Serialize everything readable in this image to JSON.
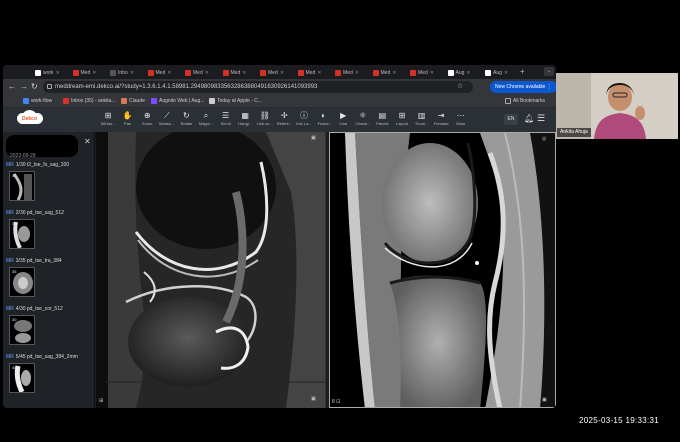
{
  "tabs": [
    {
      "label": "work",
      "color": "#ffffff"
    },
    {
      "label": "Med",
      "color": "#d93025"
    },
    {
      "label": "Inbo",
      "color": "#555555"
    },
    {
      "label": "Med",
      "color": "#d93025"
    },
    {
      "label": "Med",
      "color": "#d93025"
    },
    {
      "label": "Med",
      "color": "#d93025"
    },
    {
      "label": "Med",
      "color": "#d93025"
    },
    {
      "label": "Med",
      "color": "#d93025"
    },
    {
      "label": "Med",
      "color": "#d93025"
    },
    {
      "label": "Med",
      "color": "#d93025"
    },
    {
      "label": "Med",
      "color": "#d93025"
    },
    {
      "label": "Aug",
      "color": "#ffffff"
    },
    {
      "label": "Aug",
      "color": "#ffffff"
    }
  ],
  "address_bar": {
    "url": "meddream-emi.dekco.ai/?study=1.3.6.1.4.1.58981.29498098335632863880491630926141093993",
    "chrome_button": "New Chrome available"
  },
  "bookmarks": [
    {
      "label": "work-flow",
      "color": "#4285f4"
    },
    {
      "label": "Inbox (35) - ankita...",
      "color": "#d93025"
    },
    {
      "label": "Claude",
      "color": "#d97757"
    },
    {
      "label": "Augnito Web | Aug...",
      "color": "#7c4dff"
    },
    {
      "label": "Today at Apple - C...",
      "color": "#cccccc"
    }
  ],
  "all_bookmarks": "All Bookmarks",
  "logo_text": "Dekco",
  "toolbar": [
    {
      "label": "Windo...",
      "icon": "⊞",
      "name": "windows"
    },
    {
      "label": "Pan",
      "icon": "✋",
      "name": "pan"
    },
    {
      "label": "Zoom",
      "icon": "⊕",
      "name": "zoom"
    },
    {
      "label": "Measu...",
      "icon": "⟋",
      "name": "measure"
    },
    {
      "label": "Rotate",
      "icon": "↻",
      "name": "rotate"
    },
    {
      "label": "Magni...",
      "icon": "⌕",
      "name": "magnify"
    },
    {
      "label": "Scroll",
      "icon": "☰",
      "name": "scroll"
    },
    {
      "label": "Hangi...",
      "icon": "▦",
      "name": "hanging"
    },
    {
      "label": "Link sc...",
      "icon": "⛓",
      "name": "link-scroll"
    },
    {
      "label": "Refere...",
      "icon": "✢",
      "name": "reference"
    },
    {
      "label": "Info La...",
      "icon": "ⓘ",
      "name": "info-layer"
    },
    {
      "label": "Fusion",
      "icon": "◐",
      "name": "fusion"
    },
    {
      "label": "Cine",
      "icon": "▶",
      "name": "cine"
    },
    {
      "label": "Chann...",
      "icon": "⚛",
      "name": "channels"
    },
    {
      "label": "Panels",
      "icon": "▤",
      "name": "panels"
    },
    {
      "label": "Layout",
      "icon": "⊞",
      "name": "layout"
    },
    {
      "label": "Thum...",
      "icon": "▥",
      "name": "thumbnails"
    },
    {
      "label": "Forward",
      "icon": "⇥",
      "name": "forward"
    },
    {
      "label": "More",
      "icon": "⋯",
      "name": "more"
    }
  ],
  "language": "EN",
  "patient_date": "2023-09-29",
  "series": [
    {
      "label": "1/30 t2_tse_fs_sag_320",
      "count": "30"
    },
    {
      "label": "2/30 pd_tse_sag_512",
      "count": "30"
    },
    {
      "label": "3/35 pd_tse_tra_384",
      "count": "35"
    },
    {
      "label": "4/30 pd_tse_cor_512",
      "count": "30"
    },
    {
      "label": "5/45 pd_tse_sag_384_2mm",
      "count": "45"
    }
  ],
  "series_modality": "MR",
  "viewport2_slice": "8",
  "webcam_name": "Ankita Ahuja",
  "timestamp": "2025-03-15  19:33:31"
}
